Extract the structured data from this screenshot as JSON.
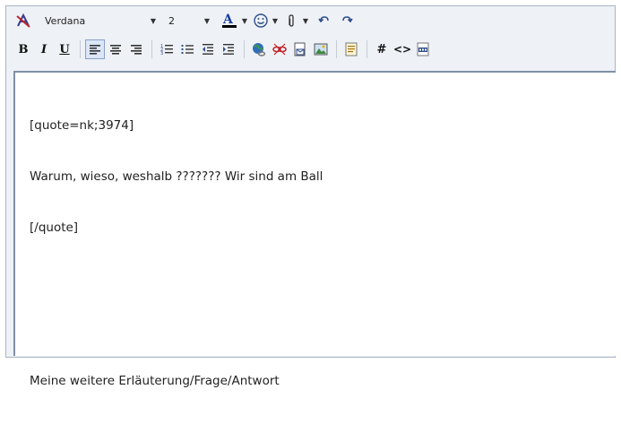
{
  "toolbar": {
    "font_family": "Verdana",
    "font_size": "2"
  },
  "buttons": {
    "bold": "B",
    "italic": "I",
    "underline": "U",
    "hash": "#",
    "code": "<>"
  },
  "editor": {
    "lines": [
      "[quote=nk;3974]",
      "Warum, wieso, weshalb ??????? Wir sind am Ball",
      "[/quote]",
      "",
      "",
      "Meine weitere Erläuterung/Frage/Antwort"
    ]
  },
  "colors": {
    "font_color_bar": "#000000",
    "toolbar_background": "#eef1f6",
    "active_button_border": "#8aa0c8"
  },
  "icons": [
    "remove-format-icon",
    "font-color-icon",
    "smiley-icon",
    "attachment-icon",
    "undo-icon",
    "redo-icon",
    "align-left-icon",
    "align-center-icon",
    "align-right-icon",
    "ordered-list-icon",
    "unordered-list-icon",
    "outdent-icon",
    "indent-icon",
    "insert-link-icon",
    "remove-link-icon",
    "insert-email-icon",
    "insert-image-icon",
    "quote-icon",
    "wrap-code-icon",
    "html-icon",
    "php-icon"
  ]
}
